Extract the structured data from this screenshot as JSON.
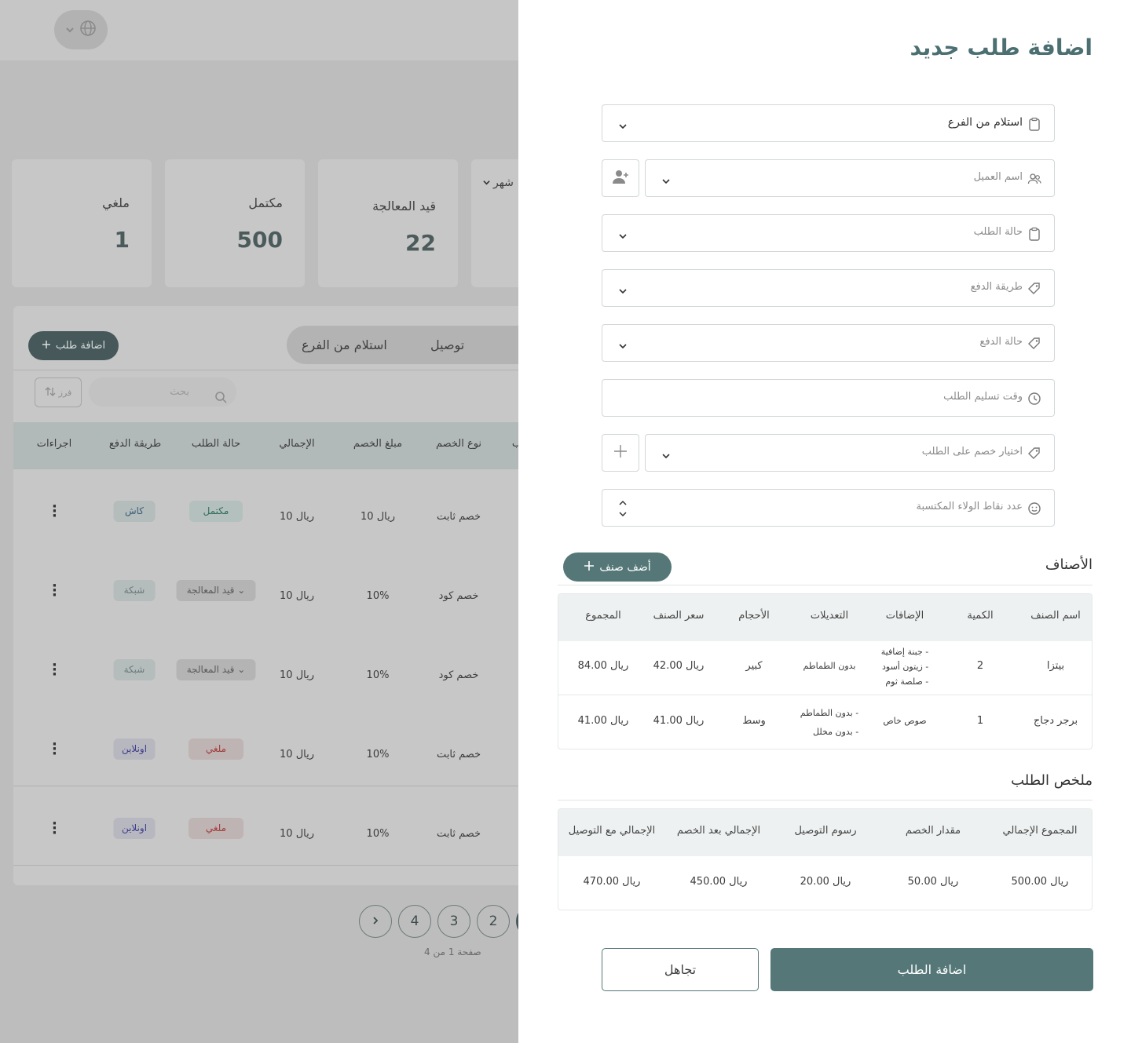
{
  "background": {
    "language_icon": "globe-icon",
    "stats": [
      {
        "title": "ملغي",
        "value": "1"
      },
      {
        "title": "مكتمل",
        "value": "500"
      },
      {
        "title": "قيد المعالجة",
        "value": "22"
      },
      {
        "title": "شهر",
        "value": ""
      }
    ],
    "add_order_label": "اضافة طلب",
    "tabs": [
      "توصيل",
      "استلام من الفرع"
    ],
    "search_placeholder": "بحث",
    "sort_label": "فرز",
    "columns": [
      "اجراءات",
      "طريقة الدفع",
      "حالة الطلب",
      "الإجمالي",
      "مبلغ الخصم",
      "نوع الخصم",
      "ب"
    ],
    "rows": [
      {
        "payment": "كاش",
        "status": "مكتمل",
        "total": "10 ريال",
        "discount": "10 ريال",
        "type": "خصم ثابت"
      },
      {
        "payment": "شبكة",
        "status": "قيد المعالجة",
        "total": "10 ريال",
        "discount": "10%",
        "type": "خصم كود"
      },
      {
        "payment": "شبكة",
        "status": "قيد المعالجة",
        "total": "10 ريال",
        "discount": "10%",
        "type": "خصم كود"
      },
      {
        "payment": "اونلاين",
        "status": "ملغي",
        "total": "10 ريال",
        "discount": "10%",
        "type": "خصم ثابت"
      },
      {
        "payment": "اونلاين",
        "status": "ملغي",
        "total": "10 ريال",
        "discount": "10%",
        "type": "خصم ثابت"
      }
    ],
    "pages": [
      "4",
      "3",
      "2"
    ],
    "page_info": "صفحة 1 من 4"
  },
  "drawer": {
    "title": "اضافة طلب جديد",
    "fields": {
      "order_type": "استلام من الفرع",
      "customer_name": "اسم العميل",
      "order_status": "حالة الطلب",
      "payment_method": "طريقة الدفع",
      "payment_status": "حالة الدفع",
      "delivery_time": "وقت تسليم الطلب",
      "discount": "اختيار خصم على الطلب",
      "loyalty_points": "عدد نقاط الولاء المكتسبة"
    },
    "items_title": "الأصناف",
    "add_item_label": "أضف صنف",
    "items_columns": [
      "اسم الصنف",
      "الكمية",
      "الإضافات",
      "التعديلات",
      "الأحجام",
      "سعر الصنف",
      "المجموع"
    ],
    "items": [
      {
        "name": "بيتزا",
        "qty": "2",
        "addons": [
          "- جبنة إضافية",
          "- زيتون أسود",
          "- صلصة ثوم"
        ],
        "mods": [
          "بدون الطماطم"
        ],
        "size": "كبير",
        "price": "42.00 ريال",
        "total": "84.00 ريال"
      },
      {
        "name": "برجر دجاج",
        "qty": "1",
        "addons": [
          "صوص خاص"
        ],
        "mods": [
          "- بدون الطماطم",
          "- بدون مخلل"
        ],
        "size": "وسط",
        "price": "41.00 ريال",
        "total": "41.00 ريال"
      }
    ],
    "summary_title": "ملخص الطلب",
    "summary_columns": [
      "المجموع الإجمالي",
      "مقدار الخصم",
      "رسوم التوصيل",
      "الإجمالي بعد الخصم",
      "الإجمالي مع التوصيل"
    ],
    "summary_values": [
      "500.00 ريال",
      "50.00 ريال",
      "20.00 ريال",
      "450.00 ريال",
      "470.00 ريال"
    ],
    "submit_label": "اضافة الطلب",
    "cancel_label": "تجاهل"
  }
}
